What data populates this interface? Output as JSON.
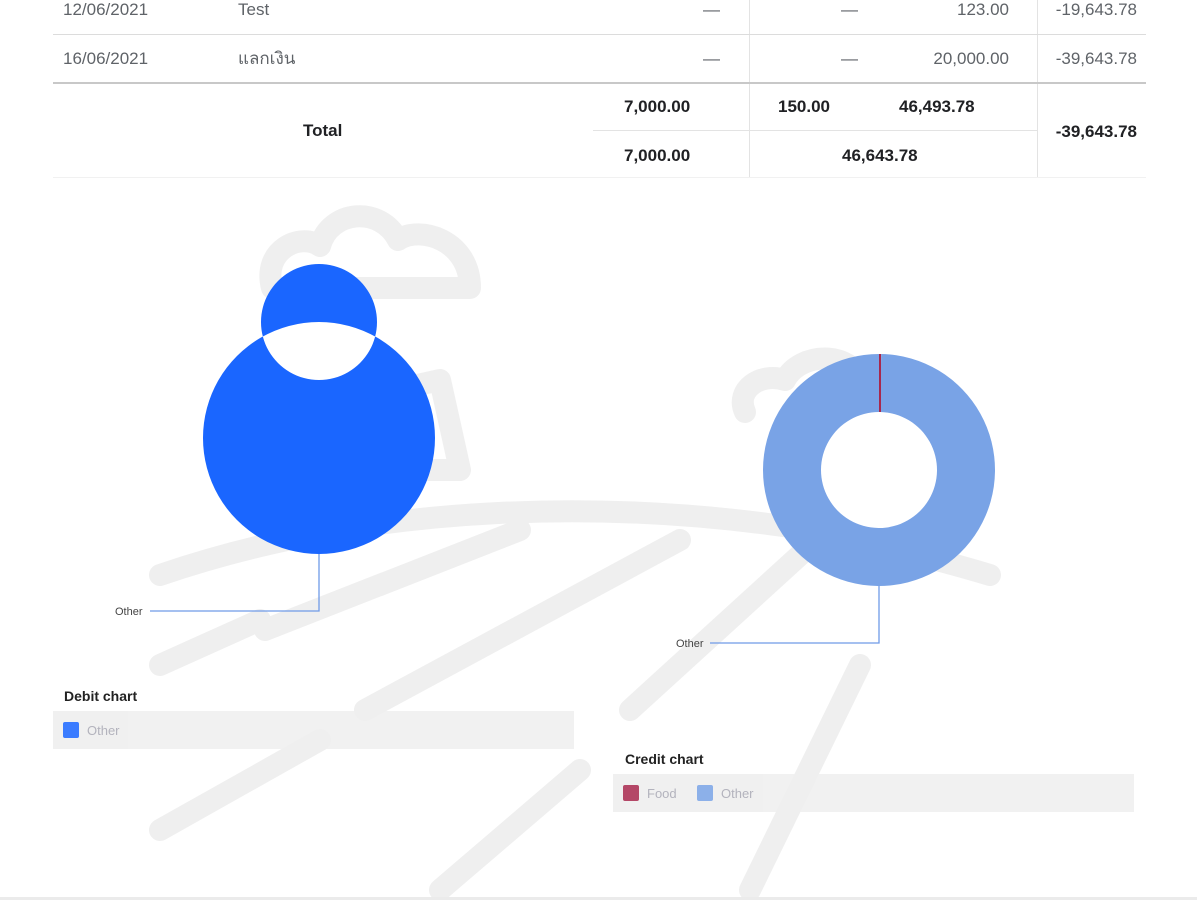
{
  "ledger": {
    "rows": [
      {
        "date": "12/06/2021",
        "description": "Test",
        "col3": "—",
        "col4": "—",
        "col5": "123.00",
        "balance": "-19,643.78"
      },
      {
        "date": "16/06/2021",
        "description": "แลกเงิน",
        "col3": "—",
        "col4": "—",
        "col5": "20,000.00",
        "balance": "-39,643.78"
      }
    ],
    "total": {
      "label": "Total",
      "top_col3": "7,000.00",
      "top_col4": "150.00",
      "top_col5": "46,493.78",
      "bottom_col3": "7,000.00",
      "bottom_combined": "46,643.78",
      "balance": "-39,643.78"
    }
  },
  "charts": {
    "debit": {
      "title": "Debit chart",
      "slice_label": "Other",
      "legend": [
        {
          "label": "Other",
          "color": "#1a66ff"
        }
      ]
    },
    "credit": {
      "title": "Credit chart",
      "slice_label": "Other",
      "legend": [
        {
          "label": "Food",
          "color": "#a8284d"
        },
        {
          "label": "Other",
          "color": "#79a3e6"
        }
      ]
    }
  },
  "chart_data": [
    {
      "type": "pie",
      "title": "Debit chart",
      "categories": [
        "Other"
      ],
      "values": [
        100
      ],
      "colors": [
        "#1a66ff"
      ],
      "legend": "bottom"
    },
    {
      "type": "pie",
      "title": "Credit chart",
      "categories": [
        "Food",
        "Other"
      ],
      "values": [
        0.3,
        99.7
      ],
      "colors": [
        "#a8284d",
        "#79a3e6"
      ],
      "legend": "bottom"
    }
  ]
}
